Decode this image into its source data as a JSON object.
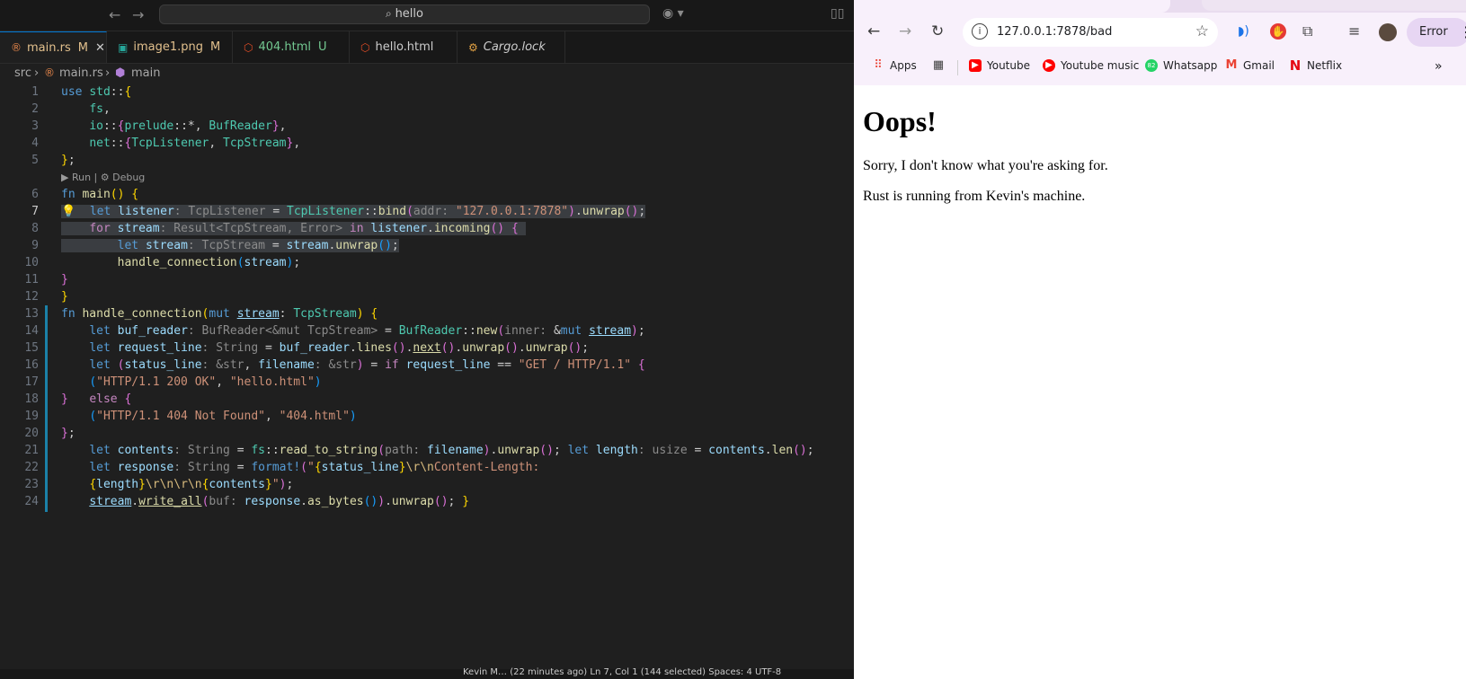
{
  "editor": {
    "search_text": "hello",
    "tabs": [
      {
        "label": "main.rs",
        "badge": "M",
        "icon": "rust-file-icon",
        "icon_color": "#e3854a",
        "label_color": "#e2c08d"
      },
      {
        "label": "image1.png",
        "badge": "M",
        "icon": "image-file-icon",
        "icon_color": "#26a69a",
        "label_color": "#e2c08d"
      },
      {
        "label": "404.html",
        "badge": "U",
        "icon": "html-file-icon",
        "icon_color": "#e44d26",
        "label_color": "#73c991"
      },
      {
        "label": "hello.html",
        "badge": "",
        "icon": "html-file-icon",
        "icon_color": "#e44d26",
        "label_color": "#cccccc"
      },
      {
        "label": "Cargo.lock",
        "badge": "",
        "icon": "lock-file-icon",
        "icon_color": "#e2a244",
        "label_color": "#cccccc"
      }
    ],
    "breadcrumb": {
      "folder": "src",
      "file": "main.rs",
      "symbol": "main"
    },
    "codelens": "▶ Run | ⚙ Debug",
    "line_numbers": [
      "1",
      "2",
      "3",
      "4",
      "5",
      "6",
      "7",
      "8",
      "9",
      "10",
      "11",
      "12",
      "13",
      "14",
      "15",
      "16",
      "17",
      "18",
      "19",
      "20",
      "21",
      "22",
      "23",
      "24"
    ],
    "current_line": 7,
    "status_text": "Kevin M…  (22 minutes ago)   Ln 7, Col 1 (144 selected)   Spaces: 4   UTF-8"
  },
  "browser": {
    "url": "127.0.0.1:7878/bad",
    "error_label": "Error",
    "bookmarks": [
      {
        "label": "Apps",
        "icon": "apps-grid-icon"
      },
      {
        "label": "",
        "icon": "tab-groups-icon"
      },
      {
        "label": "Youtube",
        "icon": "youtube-icon",
        "color": "#ff0000"
      },
      {
        "label": "Youtube music",
        "icon": "youtube-music-icon",
        "color": "#ff0000"
      },
      {
        "label": "Whatsapp",
        "icon": "whatsapp-icon",
        "color": "#25d366"
      },
      {
        "label": "Gmail",
        "icon": "gmail-icon",
        "color": "#ea4335"
      },
      {
        "label": "Netflix",
        "icon": "netflix-icon",
        "color": "#e50914"
      }
    ],
    "whatsapp_badge": "82",
    "page": {
      "heading": "Oops!",
      "paragraph1": "Sorry, I don't know what you're asking for.",
      "paragraph2": "Rust is running from Kevin's machine."
    }
  }
}
